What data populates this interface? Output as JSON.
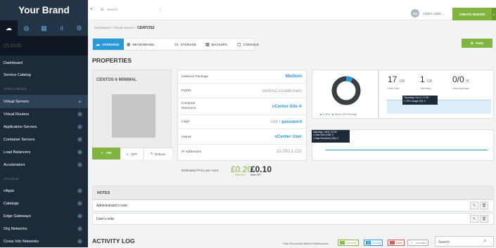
{
  "brand": {
    "name": "Your Brand"
  },
  "sidebar": {
    "section_title": "CLOUD",
    "items": [
      {
        "label": "Dashboard",
        "count": ""
      },
      {
        "label": "Service Catalog",
        "count": ""
      },
      {
        "label": "APPLIANCES",
        "count": ""
      },
      {
        "label": "Virtual Servers",
        "count": "11"
      },
      {
        "label": "Virtual Routers",
        "count": "0"
      },
      {
        "label": "Application Servers",
        "count": "1"
      },
      {
        "label": "Container Servers",
        "count": "0"
      },
      {
        "label": "Load Balancers",
        "count": "0"
      },
      {
        "label": "Accelerators",
        "count": "0"
      },
      {
        "label": "VCLOUD",
        "count": ""
      },
      {
        "label": "vApps",
        "count": "0"
      },
      {
        "label": "Catalogs",
        "count": "1"
      },
      {
        "label": "Edge Gateways",
        "count": "0"
      },
      {
        "label": "Org Networks",
        "count": "0"
      },
      {
        "label": "Cross Vdc Networks",
        "count": "0"
      }
    ],
    "icons": [
      "cloud-icon",
      "globe-icon",
      "grid-icon",
      "chart-icon",
      "gear-icon"
    ]
  },
  "topbar": {
    "back": "<",
    "search_placeholder": "Search",
    "avatar": "AU",
    "user": "ADMIN USER",
    "create": "CREATE SERVER"
  },
  "breadcrumb": {
    "a": "Dashboard",
    "b": "Virtual servers",
    "current": "CENTOS2"
  },
  "tabs": [
    {
      "label": "OVERVIEW",
      "icon": "cloud-icon"
    },
    {
      "label": "NETWORKING",
      "icon": "globe-icon"
    },
    {
      "label": "STORAGE",
      "icon": "storage-icon"
    },
    {
      "label": "BACKUPS",
      "icon": "backup-icon"
    },
    {
      "label": "CONSOLE",
      "icon": "console-icon"
    }
  ],
  "tools": "Tools",
  "properties": {
    "title": "PROPERTIES",
    "vm_name": "CENTOS 6 MINIMAL",
    "on": "ON",
    "off": "OFF",
    "reboot": "Reboot",
    "rows": [
      {
        "label": "Instance Package",
        "value": "Medium"
      },
      {
        "label": "FQDN",
        "value": "centos2.localdomain"
      },
      {
        "label": "Compute Resource",
        "value": "vCenter Site A"
      },
      {
        "label": "Login",
        "value": "root / ",
        "value2": "password"
      },
      {
        "label": "Owner",
        "value": "vCenter User"
      },
      {
        "label": "IP Addresses",
        "value": "10.200.1.151"
      }
    ],
    "price_label": "Estimated Price per Hour",
    "price_off": "£0.20",
    "price_on": "£0.10",
    "price_off_sub": "Mode ON",
    "price_on_sub": "Mode OFF"
  },
  "stats": {
    "cpu_legend": "1 CPU",
    "cpu_priority": "100% CPU Priority",
    "disk": "17",
    "disk_unit": "GB",
    "disk_label": "Disk Size",
    "memory": "1",
    "memory_unit": "GB",
    "memory_label": "Memory",
    "backups": "0/0",
    "backups_unit": "B",
    "backups_label": "Disk backups",
    "cpu_tip_time": "Thursday, Oct 3, 17:00",
    "cpu_tip_val": "• CPU Usage (%): 0",
    "net_tip_time": "Saturday, Oct 5, 02:00",
    "net_tip_sent": "• Data Sent (GB): 0",
    "net_tip_recv": "• Data Received (GB): 0",
    "donut_fill": 0.08,
    "colors": {
      "accent": "#2b9ad9",
      "green": "#82b53f",
      "dark": "#1d2a3a"
    }
  },
  "notes": {
    "title": "NOTES",
    "admin": "Administrator's note",
    "user": "User's note"
  },
  "activity": {
    "title": "ACTIVITY LOG",
    "hide": "Hide Successful Market Notifications",
    "chips": [
      {
        "label": "complete",
        "color": "#82b53f"
      },
      {
        "label": "running",
        "color": "#2b9ad9"
      },
      {
        "label": "failed",
        "color": "#d9534f"
      },
      {
        "label": "cancelled",
        "color": "#aaaaaa"
      }
    ],
    "search_placeholder": "Search"
  }
}
